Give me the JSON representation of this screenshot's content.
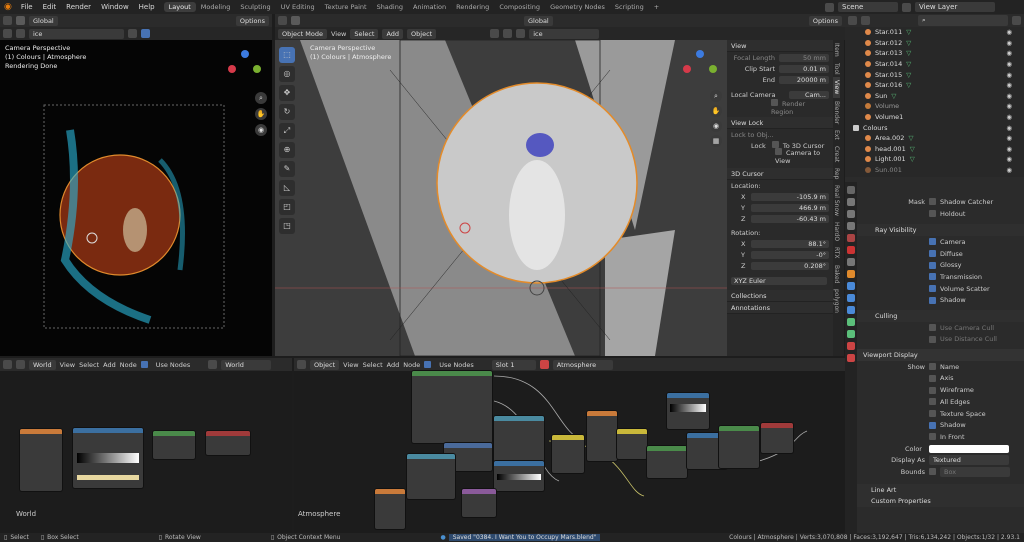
{
  "topbar": {
    "menus": [
      "File",
      "Edit",
      "Render",
      "Window",
      "Help"
    ],
    "workspaces": [
      "Layout",
      "Modeling",
      "Sculpting",
      "UV Editing",
      "Texture Paint",
      "Shading",
      "Animation",
      "Rendering",
      "Compositing",
      "Geometry Nodes",
      "Scripting"
    ],
    "active_workspace": "Layout",
    "scene": "Scene",
    "view_layer": "View Layer"
  },
  "left_view": {
    "orientation": "Global",
    "options": "Options",
    "search_value": "ice",
    "camera_label": "Camera Perspective",
    "collection_label": "(1) Colours | Atmosphere",
    "status": "Rendering Done"
  },
  "main_view": {
    "orientation": "Global",
    "options": "Options",
    "mode": "Object Mode",
    "view": "View",
    "select": "Select",
    "add": "Add",
    "object": "Object",
    "search_value": "ice",
    "camera_label": "Camera Perspective",
    "collection_label": "(1) Colours | Atmosphere"
  },
  "npanel": {
    "view_header": "View",
    "focal_length_label": "Focal Length",
    "focal_length": "50 mm",
    "clip_start_label": "Clip Start",
    "clip_start": "0.01 m",
    "end_label": "End",
    "end": "20000 m",
    "local_camera": "Local Camera",
    "local_camera_value": "Cam...",
    "render_region": "Render Region",
    "view_lock_header": "View Lock",
    "lock_to_object": "Lock to Obj...",
    "lock_label": "Lock",
    "to_3d_cursor": "To 3D Cursor",
    "camera_to_view": "Camera to View",
    "cursor_header": "3D Cursor",
    "location_label": "Location:",
    "loc_x": "-105.9 m",
    "loc_y": "466.9 m",
    "loc_z": "-60.43 m",
    "rotation_label": "Rotation:",
    "rot_x": "88.1°",
    "rot_y": "-0°",
    "rot_z": "0.208°",
    "rotation_mode": "XYZ Euler",
    "collections": "Collections",
    "annotations": "Annotations",
    "tabs": [
      "Item",
      "Tool",
      "View",
      "Blender",
      "Ext",
      "Creat",
      "Rep",
      "Real Snow",
      "HardO",
      "RTX",
      "Baked",
      "polygon"
    ]
  },
  "outliner": {
    "items": [
      {
        "name": "Star.011",
        "type": "light"
      },
      {
        "name": "Star.012",
        "type": "light"
      },
      {
        "name": "Star.013",
        "type": "light"
      },
      {
        "name": "Star.014",
        "type": "light"
      },
      {
        "name": "Star.015",
        "type": "light"
      },
      {
        "name": "Star.016",
        "type": "light"
      },
      {
        "name": "Sun",
        "type": "light"
      },
      {
        "name": "Volume",
        "type": "mesh"
      },
      {
        "name": "Volume1",
        "type": "mesh"
      },
      {
        "name": "Colours",
        "type": "collection"
      },
      {
        "name": "Area.002",
        "type": "light"
      },
      {
        "name": "head.001",
        "type": "mesh"
      },
      {
        "name": "Light.001",
        "type": "light"
      },
      {
        "name": "Sun.001",
        "type": "light"
      }
    ]
  },
  "properties": {
    "mask_label": "Mask",
    "shadow_catcher": "Shadow Catcher",
    "holdout": "Holdout",
    "ray_visibility": "Ray Visibility",
    "camera": "Camera",
    "diffuse": "Diffuse",
    "glossy": "Glossy",
    "transmission": "Transmission",
    "volume_scatter": "Volume Scatter",
    "shadow": "Shadow",
    "culling": "Culling",
    "use_camera_cull": "Use Camera Cull",
    "use_distance_cull": "Use Distance Cull",
    "viewport_display": "Viewport Display",
    "show_label": "Show",
    "name": "Name",
    "axis": "Axis",
    "wireframe": "Wireframe",
    "all_edges": "All Edges",
    "texture_space": "Texture Space",
    "shadow2": "Shadow",
    "in_front": "In Front",
    "color_label": "Color",
    "display_as_label": "Display As",
    "display_as": "Textured",
    "bounds_label": "Bounds",
    "bounds_value": "Box",
    "line_art": "Line Art",
    "custom_properties": "Custom Properties"
  },
  "world_editor": {
    "type": "World",
    "view": "View",
    "select": "Select",
    "add": "Add",
    "node": "Node",
    "use_nodes": "Use Nodes",
    "world_name": "World",
    "footer": "World"
  },
  "shader_editor": {
    "object_type": "Object",
    "view": "View",
    "select": "Select",
    "add": "Add",
    "node": "Node",
    "use_nodes": "Use Nodes",
    "slot": "Slot 1",
    "material": "Atmosphere",
    "footer": "Atmosphere"
  },
  "status": {
    "select": "Select",
    "box_select": "Box Select",
    "rotate_view": "Rotate View",
    "context_menu": "Object Context Menu",
    "saved": "Saved \"0384. I Want You to Occupy Mars.blend\"",
    "stats": "Colours | Atmosphere | Verts:3,070,808 | Faces:3,192,647 | Tris:6,134,242 | Objects:1/32 | 2.93.1"
  }
}
